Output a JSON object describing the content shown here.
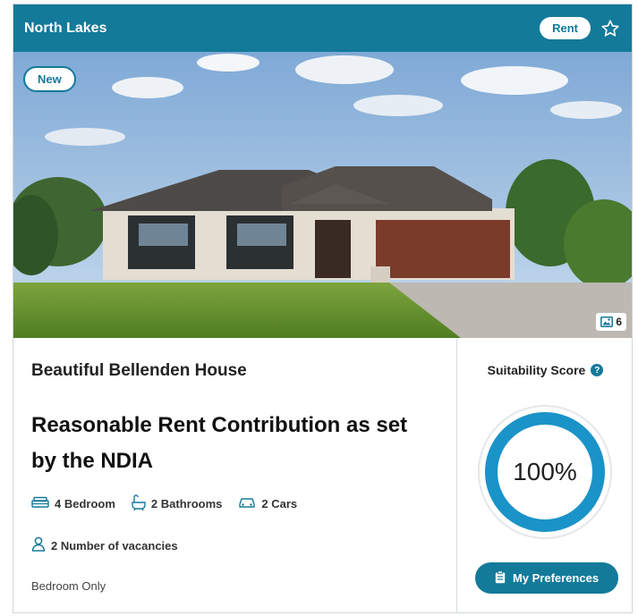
{
  "header": {
    "location": "North Lakes",
    "listing_type": "Rent"
  },
  "photo": {
    "badge": "New",
    "count": "6"
  },
  "listing": {
    "title": "Beautiful Bellenden House",
    "headline": "Reasonable Rent Contribution as set by the NDIA",
    "features": [
      {
        "icon": "bed-icon",
        "label": "4 Bedroom"
      },
      {
        "icon": "bath-icon",
        "label": "2 Bathrooms"
      },
      {
        "icon": "car-icon",
        "label": "2 Cars"
      }
    ],
    "vacancies": "2 Number of vacancies",
    "room_type": "Bedroom Only"
  },
  "score": {
    "label": "Suitability Score",
    "value_text": "100%",
    "value": 1.0,
    "button": "My Preferences"
  },
  "colors": {
    "brand": "#137a9a",
    "gauge_ring": "#1a93c9"
  }
}
